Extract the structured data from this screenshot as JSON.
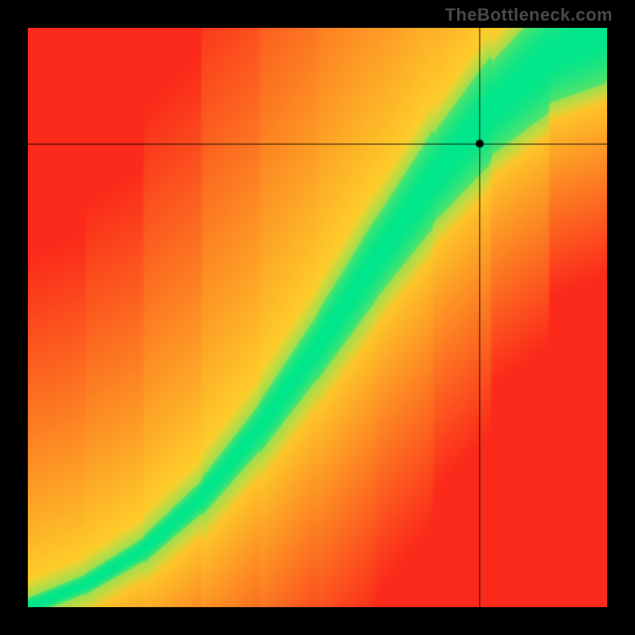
{
  "watermark": "TheBottleneck.com",
  "chart_data": {
    "type": "heatmap",
    "title": "",
    "xlabel": "",
    "ylabel": "",
    "xlim": [
      0,
      1
    ],
    "ylim": [
      0,
      1
    ],
    "colorscale_description": "Diverging red→yellow→green; green band traces an optimal-balance curve; distance from the curve maps to red (worst) through yellow to green (best).",
    "curve_description": "Monotone increasing S-curve from bottom-left to upper-right; the green balanced region widens toward the top.",
    "curve_samples_xy": [
      [
        0.0,
        0.0
      ],
      [
        0.1,
        0.04
      ],
      [
        0.2,
        0.1
      ],
      [
        0.3,
        0.19
      ],
      [
        0.4,
        0.31
      ],
      [
        0.5,
        0.45
      ],
      [
        0.6,
        0.6
      ],
      [
        0.7,
        0.74
      ],
      [
        0.8,
        0.86
      ],
      [
        0.9,
        0.95
      ],
      [
        1.0,
        1.0
      ]
    ],
    "marker_xy": [
      0.78,
      0.8
    ],
    "crosshair_x": 0.78,
    "crosshair_y": 0.8,
    "colors": {
      "worst": "#fb2a1a",
      "mid": "#feda2b",
      "best": "#00e68b",
      "marker": "#000000",
      "crosshair": "#000000",
      "background": "#000000"
    }
  }
}
